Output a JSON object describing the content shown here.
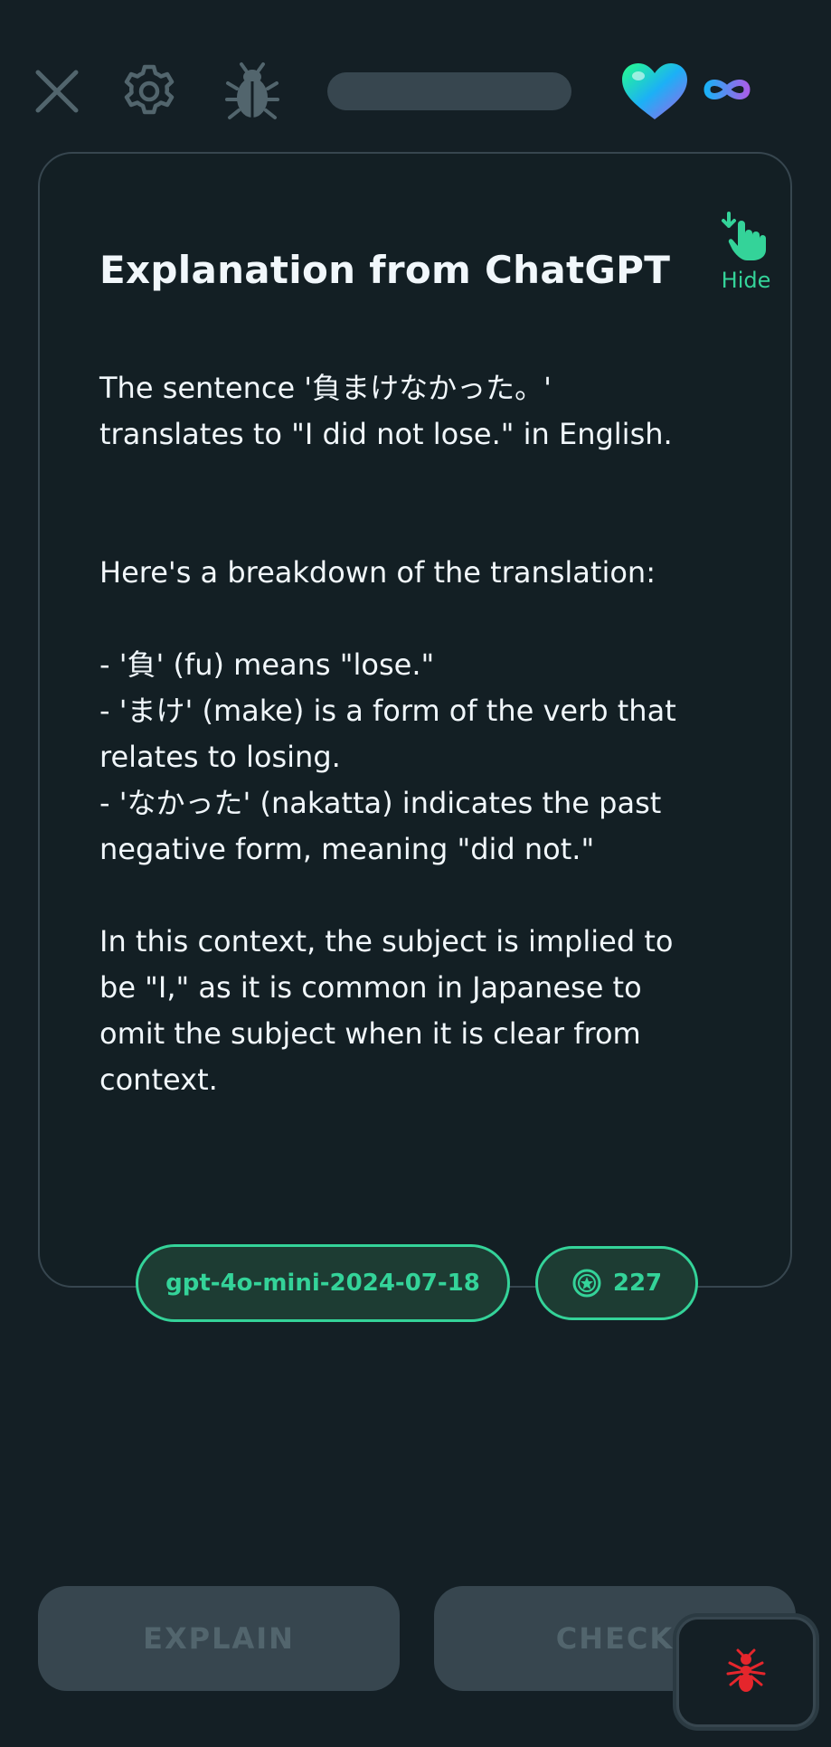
{
  "header": {
    "close_icon": "close-icon",
    "settings_icon": "gear-icon",
    "debug_icon": "bug-icon",
    "progress": 0,
    "lives_icon": "heart-icon",
    "lives_value_icon": "infinity-icon"
  },
  "card": {
    "title": "Explanation from ChatGPT",
    "hide_label": "Hide",
    "hide_icon": "tap-hand-icon",
    "body": "The sentence '負まけなかった。'\ntranslates to \"I did not lose.\" in English.\n\n\nHere's a breakdown of the translation:\n\n- '負' (fu) means \"lose.\"\n- 'まけ' (make) is a form of the verb that\nrelates to losing.\n- 'なかった' (nakatta) indicates the past\nnegative form, meaning \"did not.\"\n\nIn this context, the subject is implied to\nbe \"I,\" as it is common in Japanese to\nomit the subject when it is clear from\ncontext."
  },
  "badges": {
    "model": "gpt-4o-mini-2024-07-18",
    "count": "227",
    "count_icon": "star-coin-icon"
  },
  "buttons": {
    "explain": "EXPLAIN",
    "check": "CHECK"
  },
  "debug_fab": {
    "icon": "ant-icon"
  },
  "colors": {
    "background": "#141f25",
    "accent_green": "#34d399",
    "button_gray": "#37464f",
    "button_text": "#52656d"
  }
}
